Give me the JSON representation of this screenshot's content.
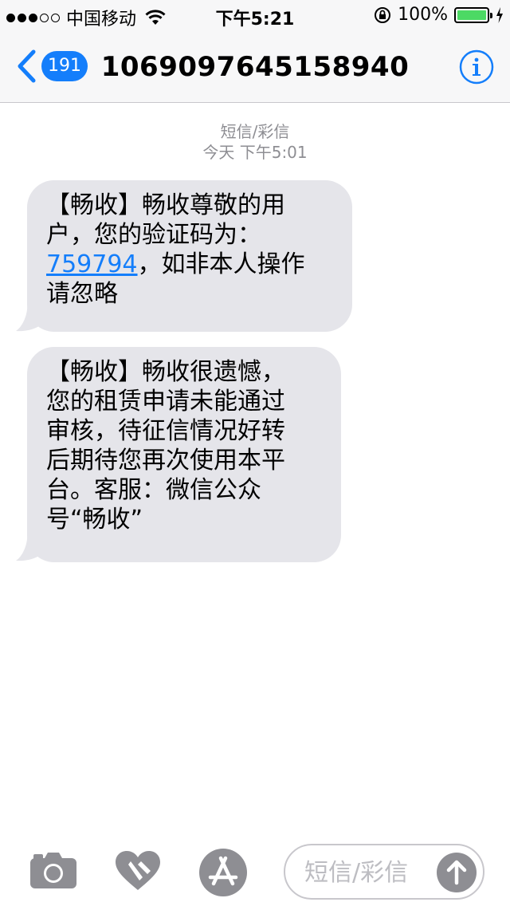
{
  "status_bar": {
    "carrier": "中国移动",
    "time": "下午5:21",
    "battery_percent": "100%",
    "battery_level": 1.0,
    "signal_dots": [
      true,
      true,
      true,
      false,
      false
    ]
  },
  "nav": {
    "back_badge": "191",
    "title": "1069097645158940"
  },
  "thread": {
    "service": "短信/彩信",
    "timestamp": "今天 下午5:01"
  },
  "messages": [
    {
      "line1": "【畅收】畅收尊敬的用",
      "line2": "户，您的验证码为：",
      "code": "759794",
      "after_code": "，如非本人操作",
      "line4": "请忽略"
    },
    {
      "lines": [
        "【畅收】畅收很遗憾，",
        "您的租赁申请未能通过",
        "审核，待征信情况好转",
        "后期待您再次使用本平",
        "台。客服：微信公众",
        "号“畅收”"
      ]
    }
  ],
  "input_bar": {
    "placeholder": "短信/彩信"
  },
  "colors": {
    "accent": "#147efb",
    "bubble": "#e5e5ea",
    "secondary_text": "#8e8e93",
    "battery": "#4cd964",
    "icon_gray": "#8e8e93"
  },
  "icons": {
    "camera": "camera-icon",
    "digital_touch": "heart-touch-icon",
    "app_store": "app-store-icon",
    "send": "arrow-up-icon",
    "info": "info-icon",
    "back": "chevron-left-icon"
  }
}
